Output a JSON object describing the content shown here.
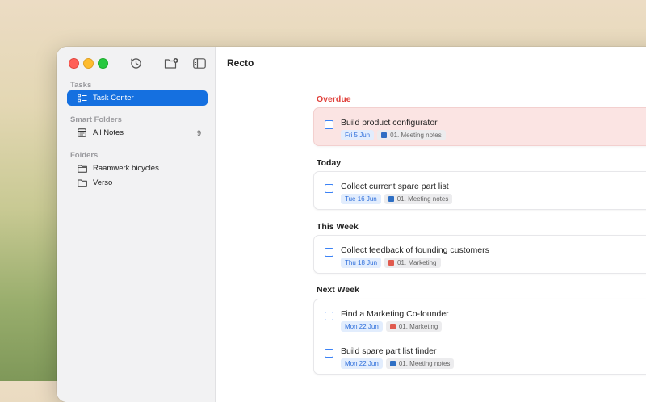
{
  "window": {
    "title": "Recto"
  },
  "toolbar": {
    "icons": [
      "sync-icon",
      "new-folder-icon",
      "sidebar-toggle-icon"
    ]
  },
  "sidebar": {
    "tasks_label": "Tasks",
    "task_center": "Task Center",
    "smart_folders_label": "Smart Folders",
    "all_notes": "All Notes",
    "all_notes_count": "9",
    "folders_label": "Folders",
    "folders": [
      "Raamwerk bicycles",
      "Verso"
    ]
  },
  "groups": {
    "overdue": {
      "title": "Overdue",
      "tasks": [
        {
          "title": "Build product configurator",
          "date": "Fri 5 Jun",
          "project": "01. Meeting notes",
          "project_icon": "book-icon",
          "project_color": "#2e6fc4"
        }
      ]
    },
    "today": {
      "title": "Today",
      "tasks": [
        {
          "title": "Collect current spare part list",
          "date": "Tue 16 Jun",
          "project": "01. Meeting notes",
          "project_icon": "book-icon",
          "project_color": "#2e6fc4"
        }
      ]
    },
    "this_week": {
      "title": "This Week",
      "tasks": [
        {
          "title": "Collect feedback of founding customers",
          "date": "Thu 18 Jun",
          "project": "01. Marketing",
          "project_icon": "ticket-icon",
          "project_color": "#e05a4e"
        }
      ]
    },
    "next_week": {
      "title": "Next Week",
      "tasks": [
        {
          "title": "Find a Marketing Co-founder",
          "date": "Mon 22 Jun",
          "project": "01. Marketing",
          "project_icon": "ticket-icon",
          "project_color": "#e05a4e"
        },
        {
          "title": "Build spare part list finder",
          "date": "Mon 22 Jun",
          "project": "01. Meeting notes",
          "project_icon": "book-icon",
          "project_color": "#2e6fc4"
        }
      ]
    }
  }
}
